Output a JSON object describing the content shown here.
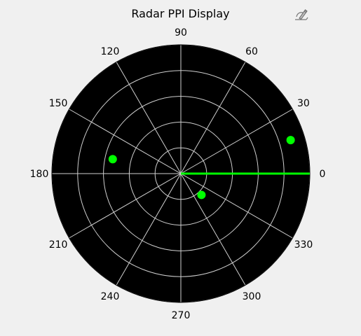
{
  "chart_data": {
    "type": "scatter",
    "subtype": "polar",
    "title": "Radar PPI Display",
    "theta_ticks": [
      "0",
      "30",
      "60",
      "90",
      "120",
      "150",
      "180",
      "210",
      "240",
      "270",
      "300",
      "330"
    ],
    "r_max": 1.0,
    "r_gridlines": [
      0.2,
      0.4,
      0.6,
      0.8,
      1.0
    ],
    "theta_gridline_step_deg": 30,
    "sweep_angle_deg": 0,
    "points": [
      {
        "theta_deg": 17,
        "r": 0.89
      },
      {
        "theta_deg": 168,
        "r": 0.54
      },
      {
        "theta_deg": 314,
        "r": 0.23
      },
      {
        "theta_deg": 90,
        "r": 0.0
      }
    ],
    "grid": true
  },
  "colors": {
    "background": "#f0f0f0",
    "plot_background": "#000000",
    "grid": "#cfcfcf",
    "target": "#00ff00",
    "sweep": "#00ff00"
  },
  "toolbar": {
    "edit_icon": "edit-axes-icon"
  }
}
